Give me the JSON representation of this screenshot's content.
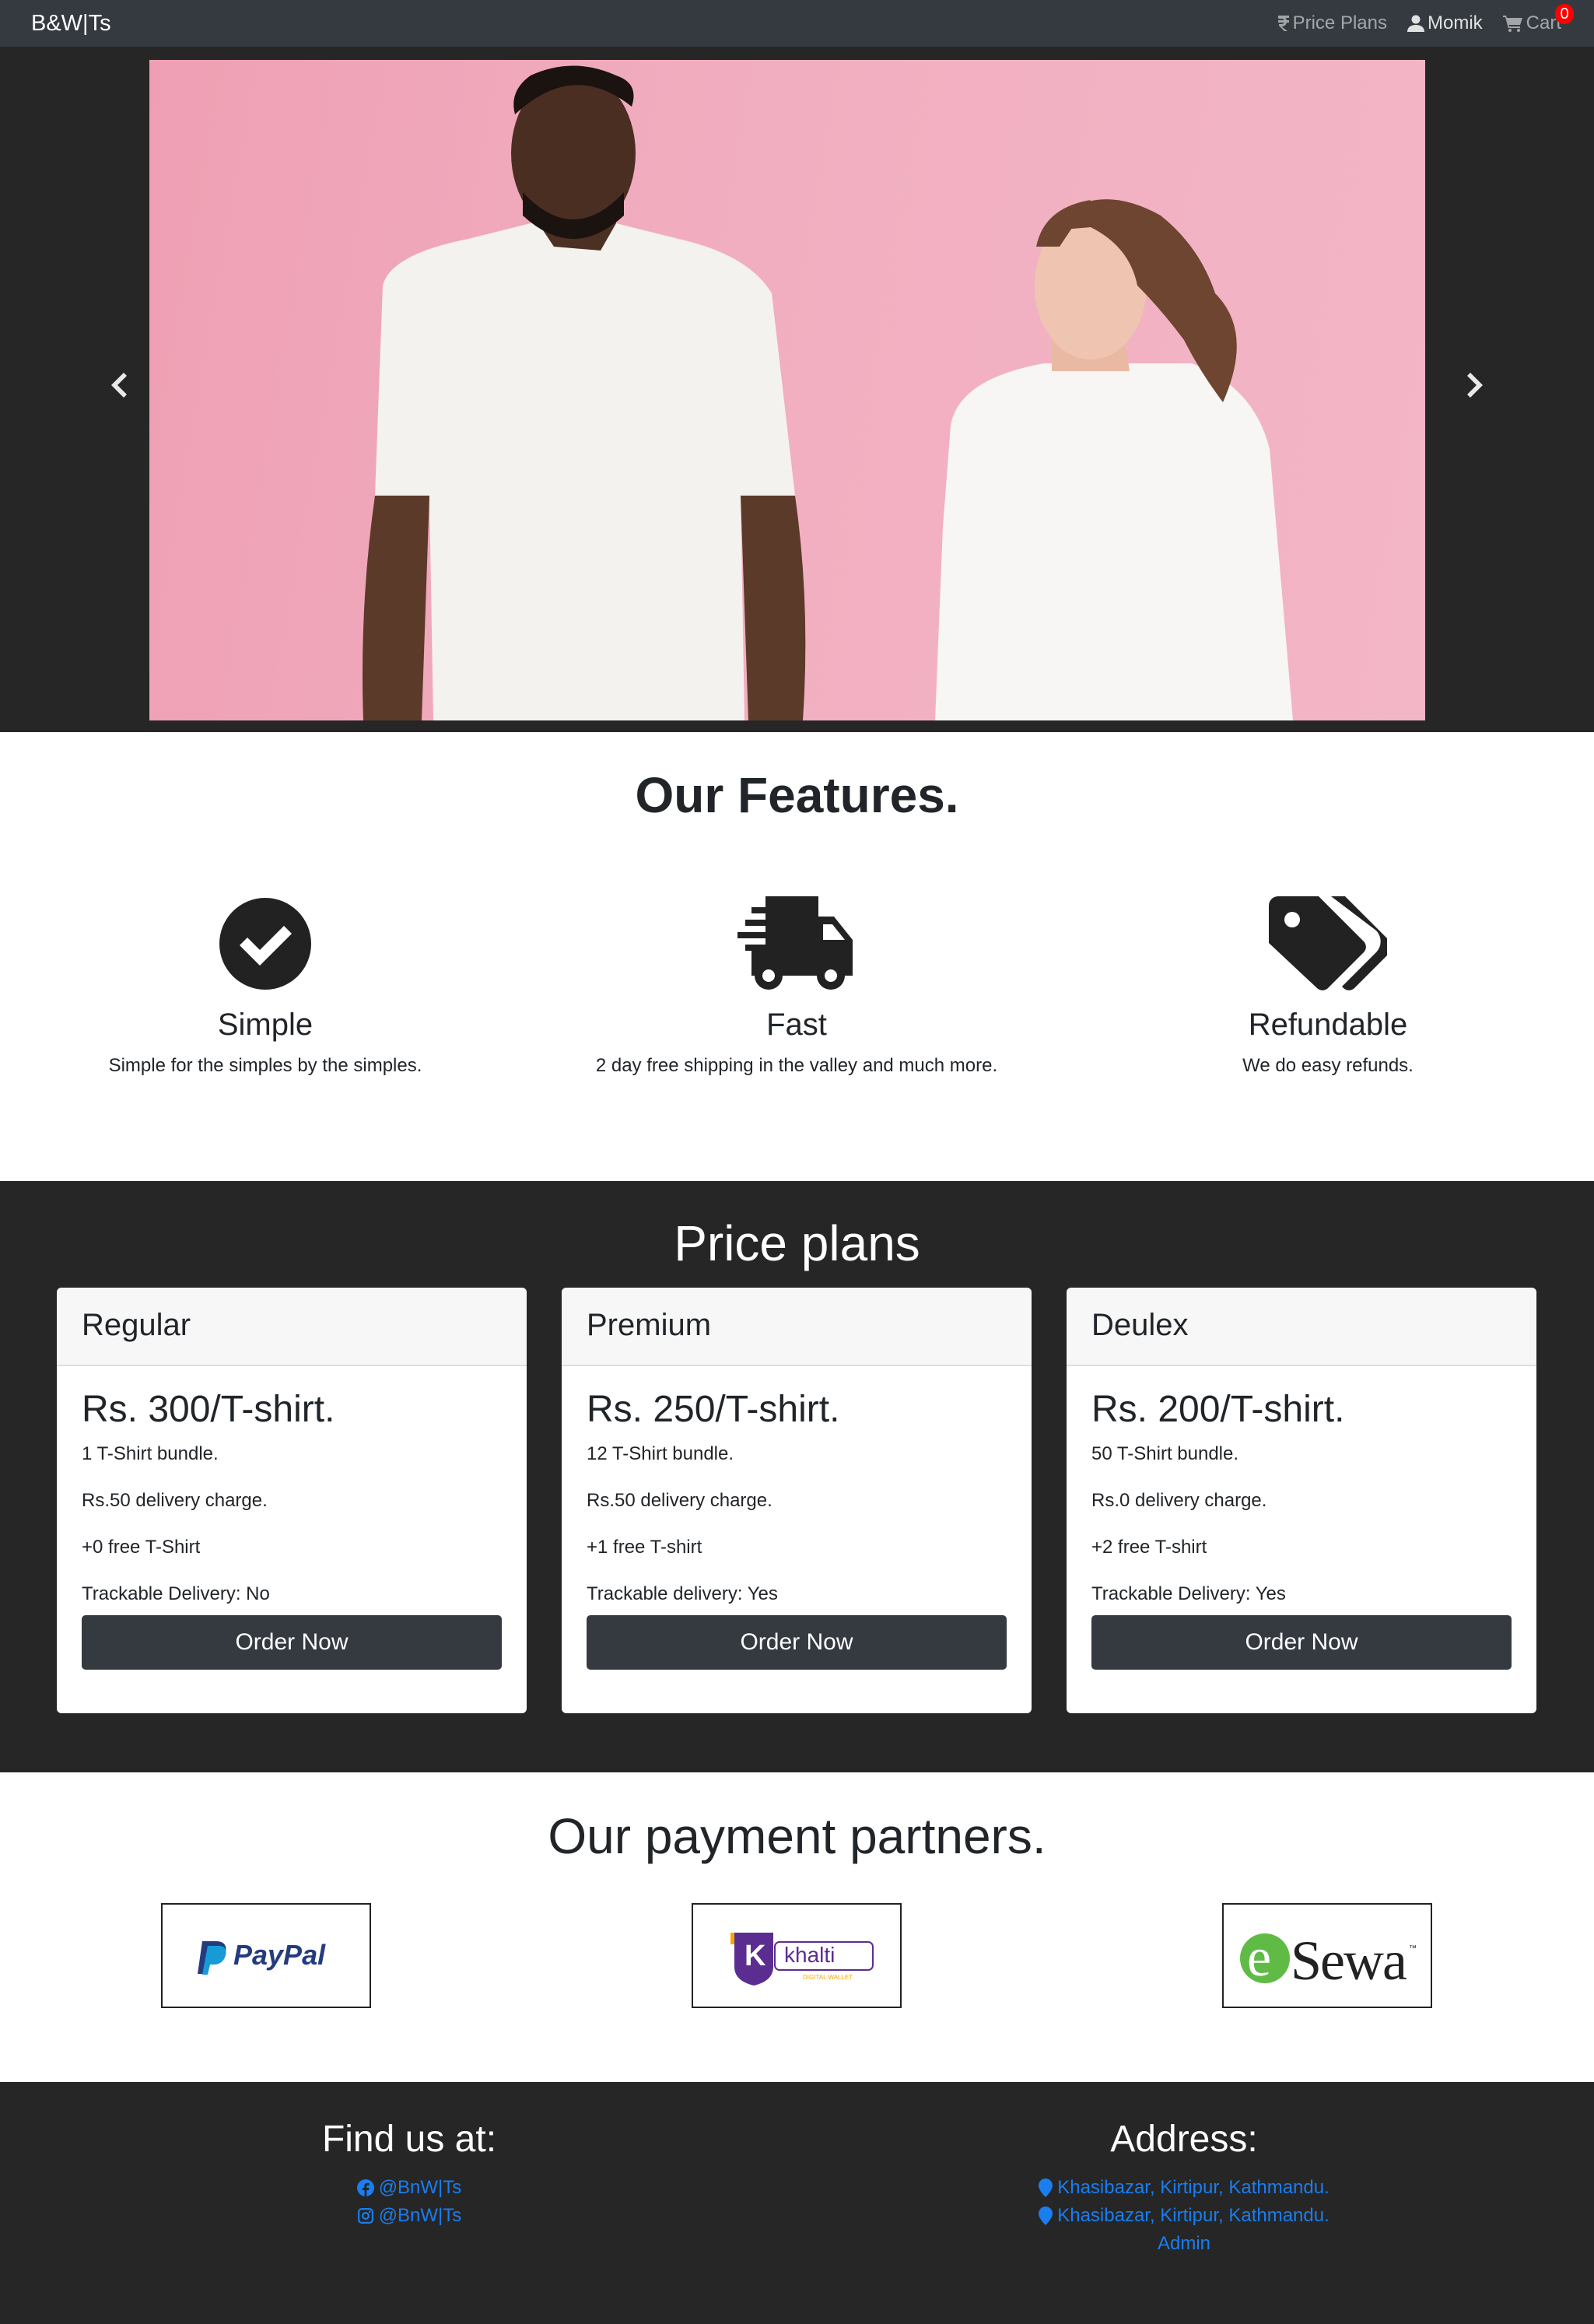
{
  "navbar": {
    "brand": "B&W|Ts",
    "price_plans": "Price Plans",
    "user": "Momik",
    "cart": "Cart",
    "cart_count": "0"
  },
  "features": {
    "title": "Our Features.",
    "items": [
      {
        "icon": "check-circle-icon",
        "title": "Simple",
        "desc": "Simple for the simples by the simples."
      },
      {
        "icon": "truck-icon",
        "title": "Fast",
        "desc": "2 day free shipping in the valley and much more."
      },
      {
        "icon": "tags-icon",
        "title": "Refundable",
        "desc": "We do easy refunds."
      }
    ]
  },
  "pricing": {
    "title": "Price plans",
    "plans": [
      {
        "name": "Regular",
        "price": "Rs. 300/T-shirt.",
        "bundle": "1 T-Shirt bundle.",
        "delivery": "Rs.50 delivery charge.",
        "free": "+0 free T-Shirt",
        "trackable": "Trackable Delivery: No",
        "button": "Order Now"
      },
      {
        "name": "Premium",
        "price": "Rs. 250/T-shirt.",
        "bundle": "12 T-Shirt bundle.",
        "delivery": "Rs.50 delivery charge.",
        "free": "+1 free T-shirt",
        "trackable": "Trackable delivery: Yes",
        "button": "Order Now"
      },
      {
        "name": "Deulex",
        "price": "Rs. 200/T-shirt.",
        "bundle": "50 T-Shirt bundle.",
        "delivery": "Rs.0 delivery charge.",
        "free": "+2 free T-shirt",
        "trackable": "Trackable Delivery: Yes",
        "button": "Order Now"
      }
    ]
  },
  "partners": {
    "title": "Our payment partners.",
    "items": [
      "PayPal",
      "khalti",
      "DIGITAL WALLET",
      "e",
      "Sewa",
      "™"
    ]
  },
  "footer": {
    "find_us": "Find us at:",
    "facebook": "@BnW|Ts",
    "instagram": "@BnW|Ts",
    "address_heading": "Address:",
    "address1": "Khasibazar, Kirtipur, Kathmandu.",
    "address2": "Khasibazar, Kirtipur, Kathmandu.",
    "admin": "Admin"
  },
  "colors": {
    "navbar": "#343a40",
    "dark_section": "#262626",
    "link": "#1a7df0",
    "badge": "#ff0000",
    "hero_bg": "#f1aec0"
  }
}
